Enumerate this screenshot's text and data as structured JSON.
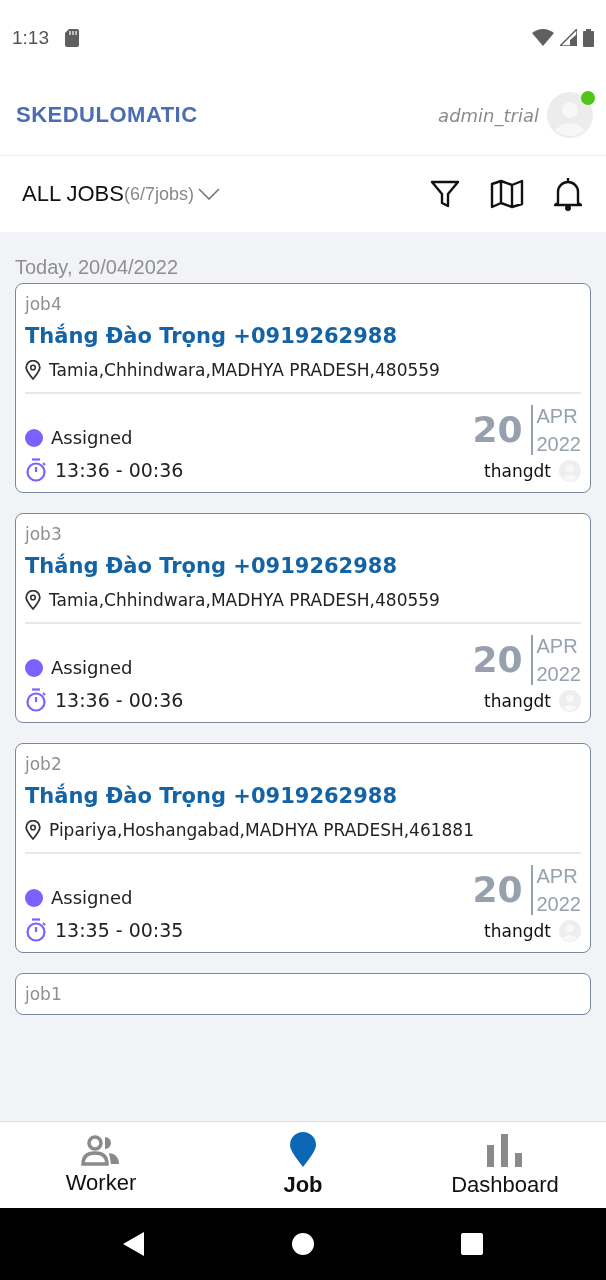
{
  "status_bar": {
    "time": "1:13"
  },
  "header": {
    "brand": "SKEDULOMATIC",
    "user": "admin_trial",
    "online": true
  },
  "toolbar": {
    "title": "ALL JOBS",
    "count": "(6/7jobs)"
  },
  "date_heading": "Today, 20/04/2022",
  "jobs": [
    {
      "id": "job4",
      "customer": "Thắng Đào Trọng +0919262988",
      "address": "Tamia,Chhindwara,MADHYA PRADESH,480559",
      "status": "Assigned",
      "color": "#7b61ff",
      "time": "13:36 - 00:36",
      "day": "20",
      "month": "APR",
      "year": "2022",
      "assignee": "thangdt"
    },
    {
      "id": "job3",
      "customer": "Thắng Đào Trọng +0919262988",
      "address": "Tamia,Chhindwara,MADHYA PRADESH,480559",
      "status": "Assigned",
      "color": "#7b61ff",
      "time": "13:36 - 00:36",
      "day": "20",
      "month": "APR",
      "year": "2022",
      "assignee": "thangdt"
    },
    {
      "id": "job2",
      "customer": "Thắng Đào Trọng +0919262988",
      "address": "Pipariya,Hoshangabad,MADHYA PRADESH,461881",
      "status": "Assigned",
      "color": "#7b61ff",
      "time": "13:35 - 00:35",
      "day": "20",
      "month": "APR",
      "year": "2022",
      "assignee": "thangdt"
    },
    {
      "id": "job1"
    }
  ],
  "nav": [
    {
      "label": "Worker",
      "kind": "worker",
      "selected": false
    },
    {
      "label": "Job",
      "kind": "job",
      "selected": true
    },
    {
      "label": "Dashboard",
      "kind": "dashboard",
      "selected": false
    }
  ]
}
